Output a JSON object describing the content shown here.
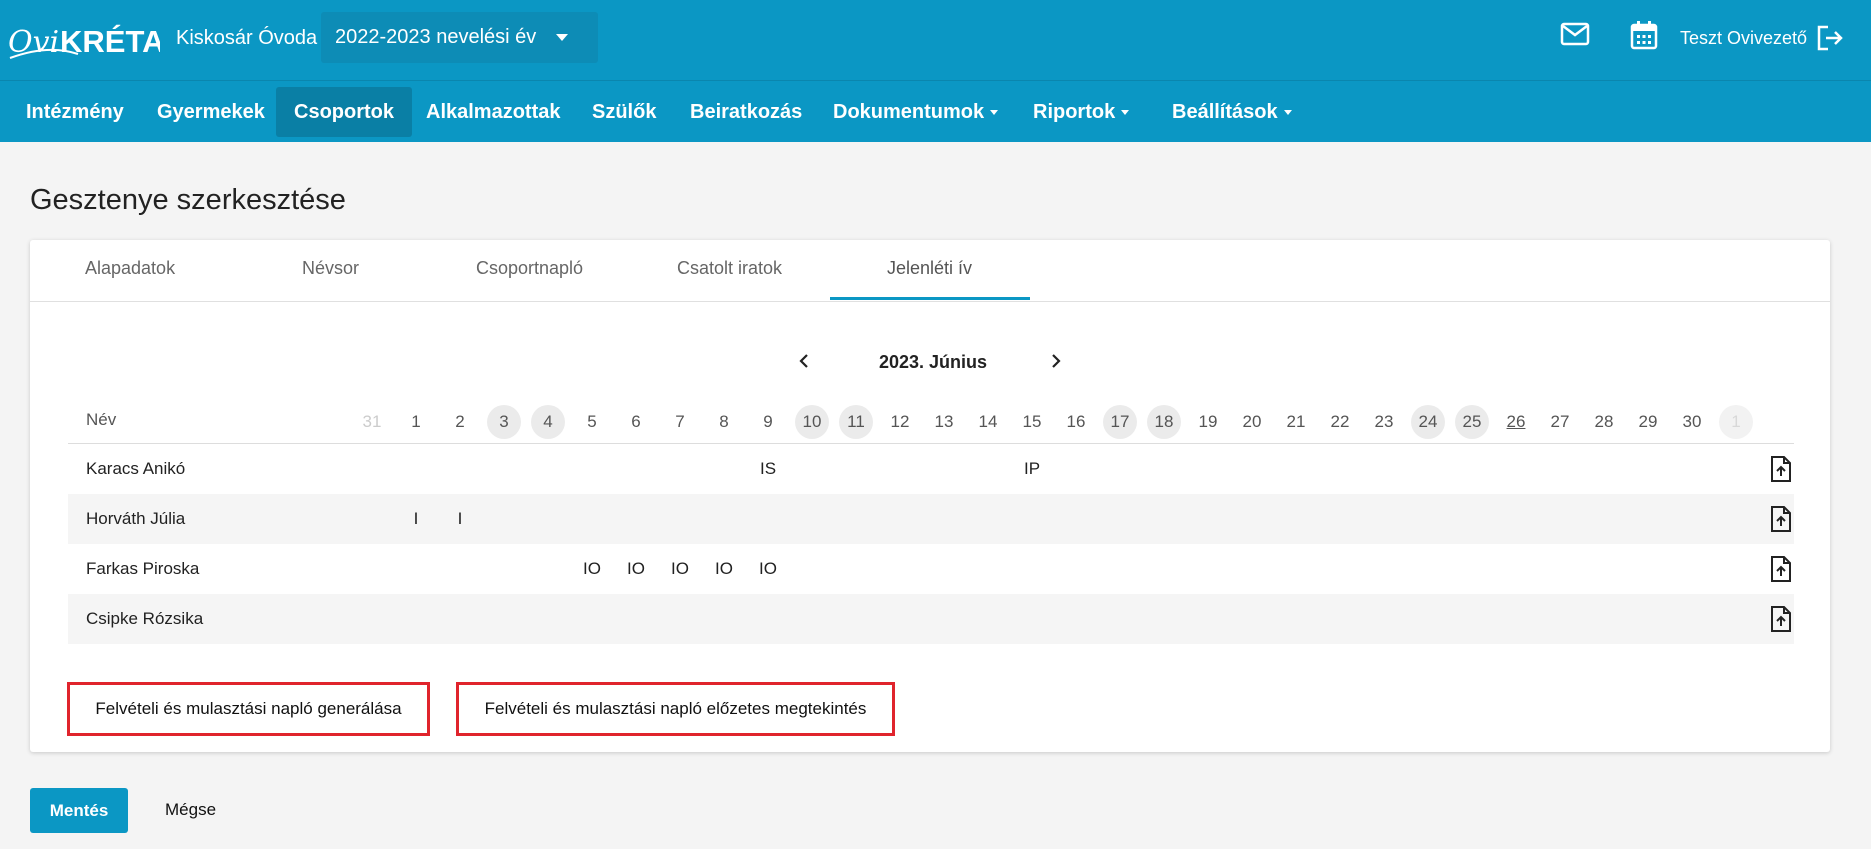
{
  "header": {
    "logo_text": "OviKRÉTA",
    "school_name": "Kiskosár Óvoda",
    "year_select": "2022-2023 nevelési év",
    "user_name": "Teszt Ovivezető",
    "colors": {
      "primary": "#0b97c4",
      "active_nav": "#0a7fa5",
      "highlight_border": "#e0242c"
    }
  },
  "nav": {
    "items": [
      {
        "label": "Intézmény"
      },
      {
        "label": "Gyermekek"
      },
      {
        "label": "Csoportok"
      },
      {
        "label": "Alkalmazottak"
      },
      {
        "label": "Szülők"
      },
      {
        "label": "Beiratkozás"
      },
      {
        "label": "Dokumentumok"
      },
      {
        "label": "Riportok"
      },
      {
        "label": "Beállítások"
      }
    ],
    "active": "Csoportok"
  },
  "page": {
    "title": "Gesztenye szerkesztése",
    "tabs": [
      {
        "label": "Alapadatok"
      },
      {
        "label": "Névsor"
      },
      {
        "label": "Csoportnapló"
      },
      {
        "label": "Csatolt iratok"
      },
      {
        "label": "Jelenléti ív"
      }
    ],
    "active_tab": "Jelenléti ív",
    "month_label": "2023. Június",
    "name_header": "Név",
    "days": [
      "31",
      "1",
      "2",
      "3",
      "4",
      "5",
      "6",
      "7",
      "8",
      "9",
      "10",
      "11",
      "12",
      "13",
      "14",
      "15",
      "16",
      "17",
      "18",
      "19",
      "20",
      "21",
      "22",
      "23",
      "24",
      "25",
      "26",
      "27",
      "28",
      "29",
      "30",
      "1"
    ],
    "rows": [
      {
        "name": "Karacs Anikó"
      },
      {
        "name": "Horváth Júlia"
      },
      {
        "name": "Farkas Piroska"
      },
      {
        "name": "Csipke Rózsika"
      }
    ],
    "marks": {
      "karacs_9": "IS",
      "karacs_15": "IP",
      "horvath_1": "I",
      "horvath_2": "I",
      "farkas_5": "IO",
      "farkas_6": "IO",
      "farkas_7": "IO",
      "farkas_8": "IO",
      "farkas_9": "IO"
    },
    "generate_button": "Felvételi és mulasztási napló generálása",
    "preview_button": "Felvételi és mulasztási napló előzetes megtekintés",
    "save_button": "Mentés",
    "cancel_button": "Mégse"
  }
}
